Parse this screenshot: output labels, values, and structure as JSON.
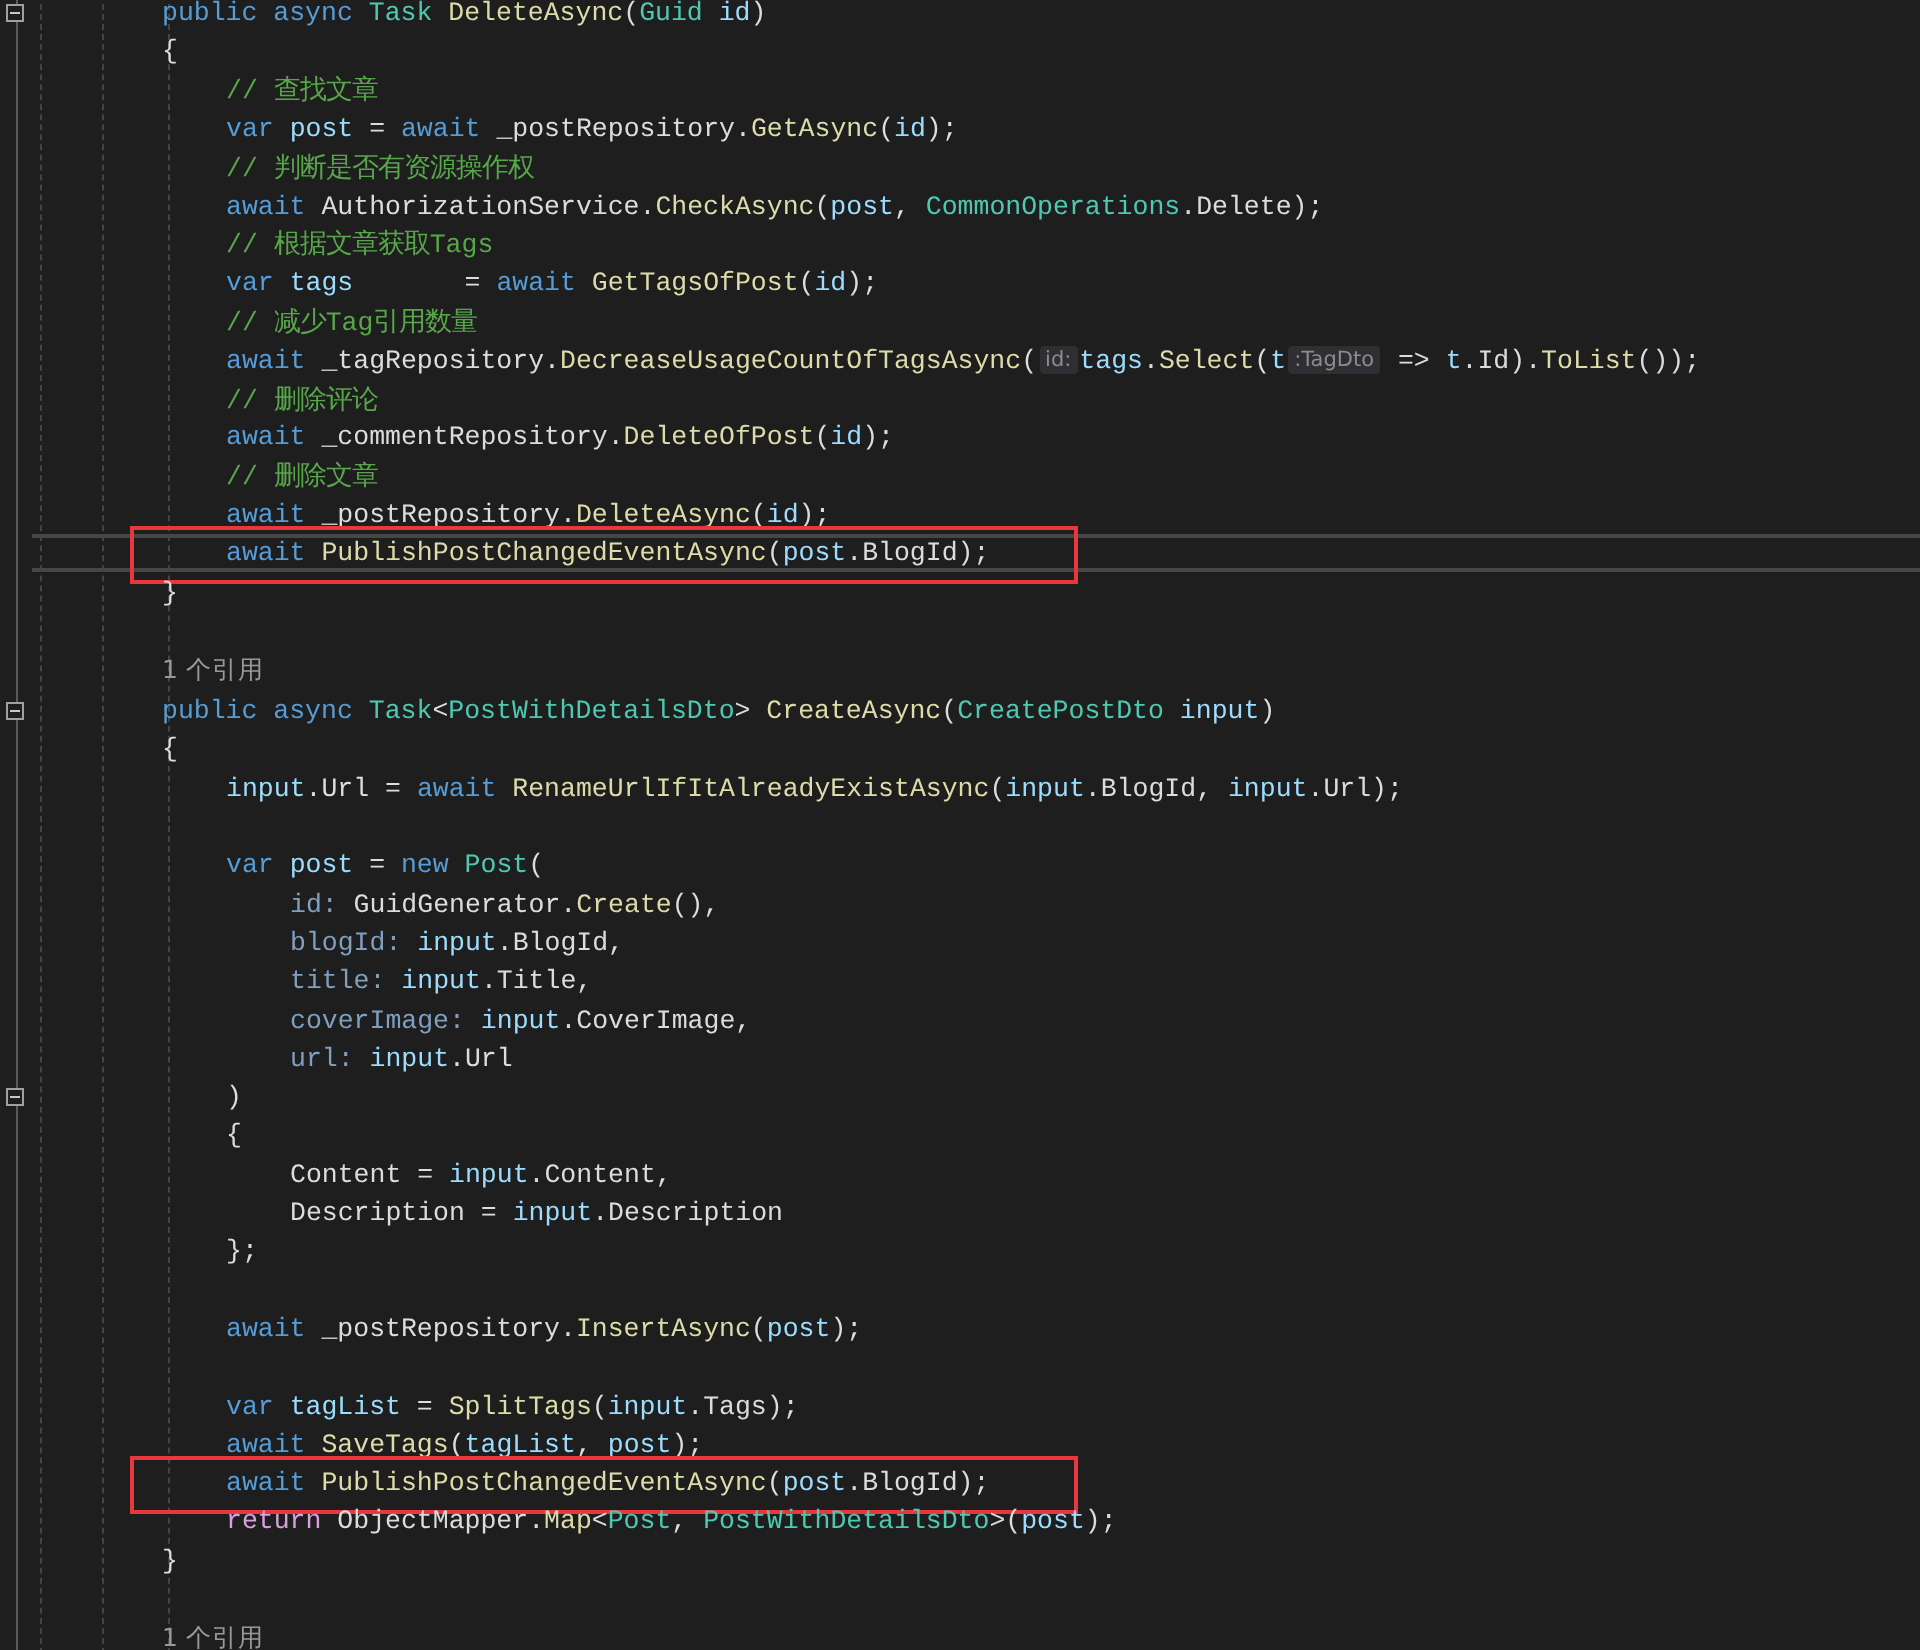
{
  "editor": {
    "lines": [
      {
        "kind": "code",
        "fold_expanded": true,
        "tokens": [
          {
            "kind": "keyword",
            "text": "public async "
          },
          {
            "kind": "type",
            "text": "Task "
          },
          {
            "kind": "method",
            "text": "DeleteAsync"
          },
          {
            "kind": "plain",
            "text": "("
          },
          {
            "kind": "type",
            "text": "Guid "
          },
          {
            "kind": "variable",
            "text": "id"
          },
          {
            "kind": "plain",
            "text": ")"
          }
        ]
      },
      {
        "kind": "code",
        "tokens": [
          {
            "kind": "plain",
            "text": "{"
          }
        ],
        "children": [
          {
            "kind": "code",
            "tokens": [
              {
                "kind": "comment",
                "text": "// 查找文章"
              }
            ]
          },
          {
            "kind": "code",
            "tokens": [
              {
                "kind": "keyword",
                "text": "var "
              },
              {
                "kind": "variable",
                "text": "post"
              },
              {
                "kind": "plain",
                "text": " = "
              },
              {
                "kind": "keyword",
                "text": "await "
              },
              {
                "kind": "plain",
                "text": "_postRepository."
              },
              {
                "kind": "method",
                "text": "GetAsync"
              },
              {
                "kind": "plain",
                "text": "("
              },
              {
                "kind": "variable",
                "text": "id"
              },
              {
                "kind": "plain",
                "text": ");"
              }
            ]
          },
          {
            "kind": "code",
            "tokens": [
              {
                "kind": "comment",
                "text": "// 判断是否有资源操作权"
              }
            ]
          },
          {
            "kind": "code",
            "tokens": [
              {
                "kind": "keyword",
                "text": "await "
              },
              {
                "kind": "plain",
                "text": "AuthorizationService."
              },
              {
                "kind": "method",
                "text": "CheckAsync"
              },
              {
                "kind": "plain",
                "text": "("
              },
              {
                "kind": "variable",
                "text": "post"
              },
              {
                "kind": "plain",
                "text": ", "
              },
              {
                "kind": "type",
                "text": "CommonOperations"
              },
              {
                "kind": "plain",
                "text": ".Delete);"
              }
            ]
          },
          {
            "kind": "code",
            "tokens": [
              {
                "kind": "comment",
                "text": "// 根据文章获取Tags"
              }
            ]
          },
          {
            "kind": "code",
            "tokens": [
              {
                "kind": "keyword",
                "text": "var "
              },
              {
                "kind": "variable",
                "text": "tags"
              },
              {
                "kind": "plain",
                "text": "       = "
              },
              {
                "kind": "keyword",
                "text": "await "
              },
              {
                "kind": "method",
                "text": "GetTagsOfPost"
              },
              {
                "kind": "plain",
                "text": "("
              },
              {
                "kind": "variable",
                "text": "id"
              },
              {
                "kind": "plain",
                "text": ");"
              }
            ]
          },
          {
            "kind": "code",
            "tokens": [
              {
                "kind": "comment",
                "text": "// 减少Tag引用数量"
              }
            ]
          },
          {
            "kind": "code",
            "tokens": [
              {
                "kind": "keyword",
                "text": "await "
              },
              {
                "kind": "plain",
                "text": "_tagRepository."
              },
              {
                "kind": "method",
                "text": "DecreaseUsageCountOfTagsAsync"
              },
              {
                "kind": "plain",
                "text": "("
              },
              {
                "kind": "hint",
                "text": "id:"
              },
              {
                "kind": "variable",
                "text": "tags"
              },
              {
                "kind": "plain",
                "text": "."
              },
              {
                "kind": "method",
                "text": "Select"
              },
              {
                "kind": "plain",
                "text": "("
              },
              {
                "kind": "variable",
                "text": "t"
              },
              {
                "kind": "hint",
                "text": ":TagDto"
              },
              {
                "kind": "plain",
                "text": " => "
              },
              {
                "kind": "variable",
                "text": "t"
              },
              {
                "kind": "plain",
                "text": ".Id)."
              },
              {
                "kind": "method",
                "text": "ToList"
              },
              {
                "kind": "plain",
                "text": "());"
              }
            ]
          },
          {
            "kind": "code",
            "tokens": [
              {
                "kind": "comment",
                "text": "// 删除评论"
              }
            ]
          },
          {
            "kind": "code",
            "tokens": [
              {
                "kind": "keyword",
                "text": "await "
              },
              {
                "kind": "plain",
                "text": "_commentRepository."
              },
              {
                "kind": "method",
                "text": "DeleteOfPost"
              },
              {
                "kind": "plain",
                "text": "("
              },
              {
                "kind": "variable",
                "text": "id"
              },
              {
                "kind": "plain",
                "text": ");"
              }
            ]
          },
          {
            "kind": "code",
            "tokens": [
              {
                "kind": "comment",
                "text": "// 删除文章"
              }
            ]
          },
          {
            "kind": "code",
            "tokens": [
              {
                "kind": "keyword",
                "text": "await "
              },
              {
                "kind": "plain",
                "text": "_postRepository."
              },
              {
                "kind": "method",
                "text": "DeleteAsync"
              },
              {
                "kind": "plain",
                "text": "("
              },
              {
                "kind": "variable",
                "text": "id"
              },
              {
                "kind": "plain",
                "text": ");"
              }
            ]
          },
          {
            "kind": "code",
            "current": true,
            "highlighted": true,
            "tokens": [
              {
                "kind": "keyword",
                "text": "await "
              },
              {
                "kind": "method",
                "text": "PublishPostChangedEventAsync"
              },
              {
                "kind": "plain",
                "text": "("
              },
              {
                "kind": "variable",
                "text": "post"
              },
              {
                "kind": "plain",
                "text": ".BlogId);"
              }
            ]
          }
        ]
      },
      {
        "kind": "code",
        "tokens": [
          {
            "kind": "plain",
            "text": "}"
          }
        ]
      },
      {
        "kind": "blank"
      },
      {
        "kind": "lens",
        "text": "1 个引用"
      },
      {
        "kind": "code",
        "fold_expanded": true,
        "tokens": [
          {
            "kind": "keyword",
            "text": "public async "
          },
          {
            "kind": "type",
            "text": "Task"
          },
          {
            "kind": "plain",
            "text": "<"
          },
          {
            "kind": "type",
            "text": "PostWithDetailsDto"
          },
          {
            "kind": "plain",
            "text": "> "
          },
          {
            "kind": "method",
            "text": "CreateAsync"
          },
          {
            "kind": "plain",
            "text": "("
          },
          {
            "kind": "type",
            "text": "CreatePostDto "
          },
          {
            "kind": "variable",
            "text": "input"
          },
          {
            "kind": "plain",
            "text": ")"
          }
        ]
      },
      {
        "kind": "code",
        "tokens": [
          {
            "kind": "plain",
            "text": "{"
          }
        ],
        "children": [
          {
            "kind": "code",
            "tokens": [
              {
                "kind": "variable",
                "text": "input"
              },
              {
                "kind": "plain",
                "text": ".Url = "
              },
              {
                "kind": "keyword",
                "text": "await "
              },
              {
                "kind": "method",
                "text": "RenameUrlIfItAlreadyExistAsync"
              },
              {
                "kind": "plain",
                "text": "("
              },
              {
                "kind": "variable",
                "text": "input"
              },
              {
                "kind": "plain",
                "text": ".BlogId, "
              },
              {
                "kind": "variable",
                "text": "input"
              },
              {
                "kind": "plain",
                "text": ".Url);"
              }
            ]
          },
          {
            "kind": "blank"
          },
          {
            "kind": "code",
            "tokens": [
              {
                "kind": "keyword",
                "text": "var "
              },
              {
                "kind": "variable",
                "text": "post"
              },
              {
                "kind": "plain",
                "text": " = "
              },
              {
                "kind": "keyword",
                "text": "new "
              },
              {
                "kind": "type",
                "text": "Post"
              },
              {
                "kind": "plain",
                "text": "("
              }
            ],
            "children": [
              {
                "kind": "code",
                "tokens": [
                  {
                    "kind": "param",
                    "text": "id:"
                  },
                  {
                    "kind": "plain",
                    "text": " GuidGenerator."
                  },
                  {
                    "kind": "method",
                    "text": "Create"
                  },
                  {
                    "kind": "plain",
                    "text": "(),"
                  }
                ]
              },
              {
                "kind": "code",
                "tokens": [
                  {
                    "kind": "param",
                    "text": "blogId: "
                  },
                  {
                    "kind": "variable",
                    "text": "input"
                  },
                  {
                    "kind": "plain",
                    "text": ".BlogId,"
                  }
                ]
              },
              {
                "kind": "code",
                "tokens": [
                  {
                    "kind": "param",
                    "text": "title: "
                  },
                  {
                    "kind": "variable",
                    "text": "input"
                  },
                  {
                    "kind": "plain",
                    "text": ".Title,"
                  }
                ]
              },
              {
                "kind": "code",
                "tokens": [
                  {
                    "kind": "param",
                    "text": "coverImage: "
                  },
                  {
                    "kind": "variable",
                    "text": "input"
                  },
                  {
                    "kind": "plain",
                    "text": ".CoverImage,"
                  }
                ]
              },
              {
                "kind": "code",
                "tokens": [
                  {
                    "kind": "param",
                    "text": "url: "
                  },
                  {
                    "kind": "variable",
                    "text": "input"
                  },
                  {
                    "kind": "plain",
                    "text": ".Url"
                  }
                ]
              }
            ]
          },
          {
            "kind": "code",
            "fold_expanded": true,
            "tokens": [
              {
                "kind": "plain",
                "text": ")"
              }
            ]
          },
          {
            "kind": "code",
            "tokens": [
              {
                "kind": "plain",
                "text": "{"
              }
            ],
            "children": [
              {
                "kind": "code",
                "tokens": [
                  {
                    "kind": "plain",
                    "text": "Content = "
                  },
                  {
                    "kind": "variable",
                    "text": "input"
                  },
                  {
                    "kind": "plain",
                    "text": ".Content,"
                  }
                ]
              },
              {
                "kind": "code",
                "tokens": [
                  {
                    "kind": "plain",
                    "text": "Description = "
                  },
                  {
                    "kind": "variable",
                    "text": "input"
                  },
                  {
                    "kind": "plain",
                    "text": ".Description"
                  }
                ]
              }
            ]
          },
          {
            "kind": "code",
            "tokens": [
              {
                "kind": "plain",
                "text": "};"
              }
            ]
          },
          {
            "kind": "blank"
          },
          {
            "kind": "code",
            "tokens": [
              {
                "kind": "keyword",
                "text": "await "
              },
              {
                "kind": "plain",
                "text": "_postRepository."
              },
              {
                "kind": "method",
                "text": "InsertAsync"
              },
              {
                "kind": "plain",
                "text": "("
              },
              {
                "kind": "variable",
                "text": "post"
              },
              {
                "kind": "plain",
                "text": ");"
              }
            ]
          },
          {
            "kind": "blank"
          },
          {
            "kind": "code",
            "tokens": [
              {
                "kind": "keyword",
                "text": "var "
              },
              {
                "kind": "variable",
                "text": "tagList"
              },
              {
                "kind": "plain",
                "text": " = "
              },
              {
                "kind": "method",
                "text": "SplitTags"
              },
              {
                "kind": "plain",
                "text": "("
              },
              {
                "kind": "variable",
                "text": "input"
              },
              {
                "kind": "plain",
                "text": ".Tags);"
              }
            ]
          },
          {
            "kind": "code",
            "tokens": [
              {
                "kind": "keyword",
                "text": "await "
              },
              {
                "kind": "method",
                "text": "SaveTags"
              },
              {
                "kind": "plain",
                "text": "("
              },
              {
                "kind": "variable",
                "text": "tagList"
              },
              {
                "kind": "plain",
                "text": ", "
              },
              {
                "kind": "variable",
                "text": "post"
              },
              {
                "kind": "plain",
                "text": ");"
              }
            ]
          },
          {
            "kind": "code",
            "highlighted": true,
            "tokens": [
              {
                "kind": "keyword",
                "text": "await "
              },
              {
                "kind": "method",
                "text": "PublishPostChangedEventAsync"
              },
              {
                "kind": "plain",
                "text": "("
              },
              {
                "kind": "variable",
                "text": "post"
              },
              {
                "kind": "plain",
                "text": ".BlogId);"
              }
            ]
          },
          {
            "kind": "code",
            "tokens": [
              {
                "kind": "control",
                "text": "return "
              },
              {
                "kind": "plain",
                "text": "ObjectMapper."
              },
              {
                "kind": "method",
                "text": "Map"
              },
              {
                "kind": "plain",
                "text": "<"
              },
              {
                "kind": "type",
                "text": "Post"
              },
              {
                "kind": "plain",
                "text": ", "
              },
              {
                "kind": "type",
                "text": "PostWithDetailsDto"
              },
              {
                "kind": "plain",
                "text": ">("
              },
              {
                "kind": "variable",
                "text": "post"
              },
              {
                "kind": "plain",
                "text": ");"
              }
            ]
          }
        ]
      },
      {
        "kind": "code",
        "tokens": [
          {
            "kind": "plain",
            "text": "}"
          }
        ]
      },
      {
        "kind": "blank"
      },
      {
        "kind": "lens",
        "text": "1 个引用"
      }
    ]
  }
}
